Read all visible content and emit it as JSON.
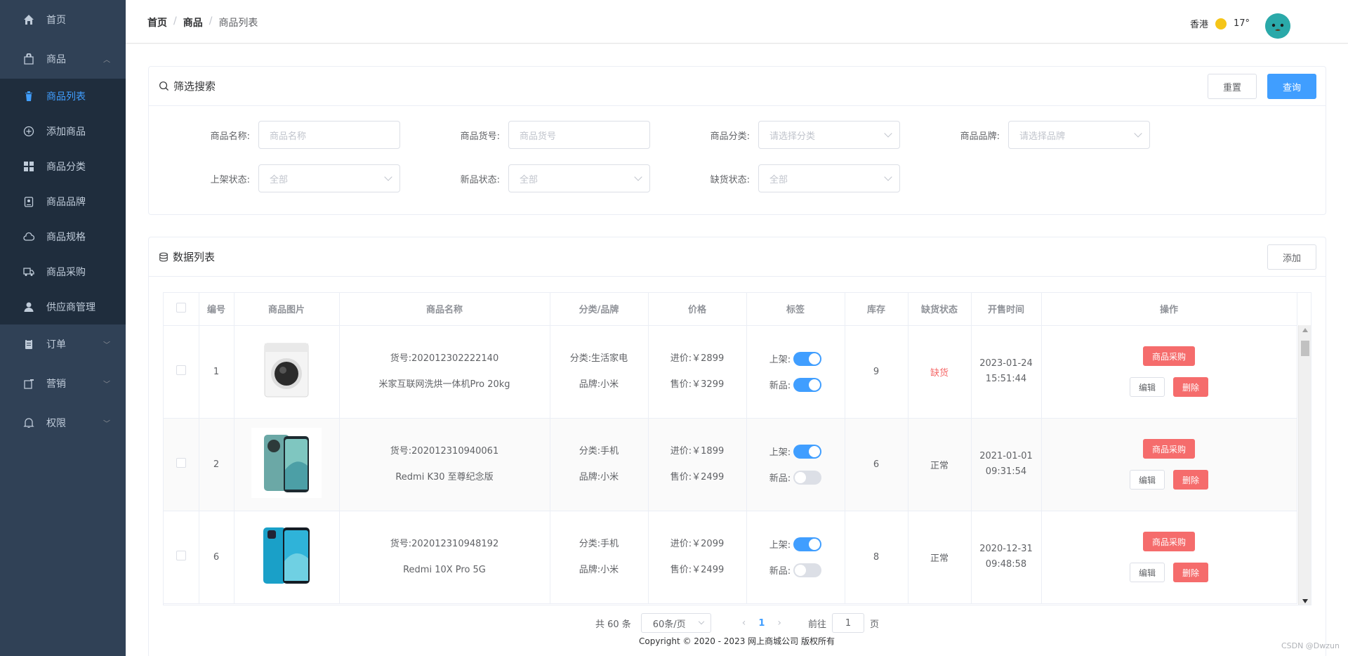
{
  "sidebar": {
    "home": "首页",
    "goods": "商品",
    "sub": [
      "商品列表",
      "添加商品",
      "商品分类",
      "商品品牌",
      "商品规格",
      "商品采购",
      "供应商管理"
    ],
    "order": "订单",
    "marketing": "营销",
    "permission": "权限"
  },
  "header": {
    "breadcrumb": [
      "首页",
      "商品",
      "商品列表"
    ],
    "city": "香港",
    "temp": "17°"
  },
  "filter": {
    "title": "筛选搜索",
    "reset": "重置",
    "query": "查询",
    "fields": {
      "name_label": "商品名称:",
      "name_ph": "商品名称",
      "sn_label": "商品货号:",
      "sn_ph": "商品货号",
      "cat_label": "商品分类:",
      "cat_ph": "请选择分类",
      "brand_label": "商品品牌:",
      "brand_ph": "请选择品牌",
      "shelf_label": "上架状态:",
      "shelf_ph": "全部",
      "new_label": "新品状态:",
      "new_ph": "全部",
      "stock_label": "缺货状态:",
      "stock_ph": "全部"
    }
  },
  "list": {
    "title": "数据列表",
    "add": "添加",
    "columns": [
      "编号",
      "商品图片",
      "商品名称",
      "分类/品牌",
      "价格",
      "标签",
      "库存",
      "缺货状态",
      "开售时间",
      "操作"
    ],
    "rows": [
      {
        "id": "1",
        "sn": "货号:202012302222140",
        "name": "米家互联网洗烘一体机Pro 20kg",
        "cat": "分类:生活家电",
        "brand": "品牌:小米",
        "cost": "进价:￥2899",
        "price": "售价:￥3299",
        "shelf_label": "上架:",
        "new_label": "新品:",
        "shelf": true,
        "is_new": true,
        "stock": "9",
        "status": "缺货",
        "date": "2023-01-24",
        "time": "15:51:44"
      },
      {
        "id": "2",
        "sn": "货号:202012310940061",
        "name": "Redmi K30 至尊纪念版",
        "cat": "分类:手机",
        "brand": "品牌:小米",
        "cost": "进价:￥1899",
        "price": "售价:￥2499",
        "shelf_label": "上架:",
        "new_label": "新品:",
        "shelf": true,
        "is_new": false,
        "stock": "6",
        "status": "正常",
        "date": "2021-01-01",
        "time": "09:31:54"
      },
      {
        "id": "6",
        "sn": "货号:202012310948192",
        "name": "Redmi 10X Pro 5G",
        "cat": "分类:手机",
        "brand": "品牌:小米",
        "cost": "进价:￥2099",
        "price": "售价:￥2499",
        "shelf_label": "上架:",
        "new_label": "新品:",
        "shelf": true,
        "is_new": false,
        "stock": "8",
        "status": "正常",
        "date": "2020-12-31",
        "time": "09:48:58"
      }
    ],
    "ops": {
      "purchase": "商品采购",
      "edit": "编辑",
      "delete": "删除"
    }
  },
  "pager": {
    "total": "共 60 条",
    "size": "60条/页",
    "page": "1",
    "goto": "前往",
    "goto_val": "1",
    "page_unit": "页"
  },
  "footer": "Copyright © 2020 - 2023 网上商城公司 版权所有",
  "watermark": "CSDN @Dwzun",
  "colors": {
    "sidebar": "#304156",
    "submenu": "#1f2d3d",
    "primary": "#409eff",
    "danger": "#f56c6c"
  }
}
